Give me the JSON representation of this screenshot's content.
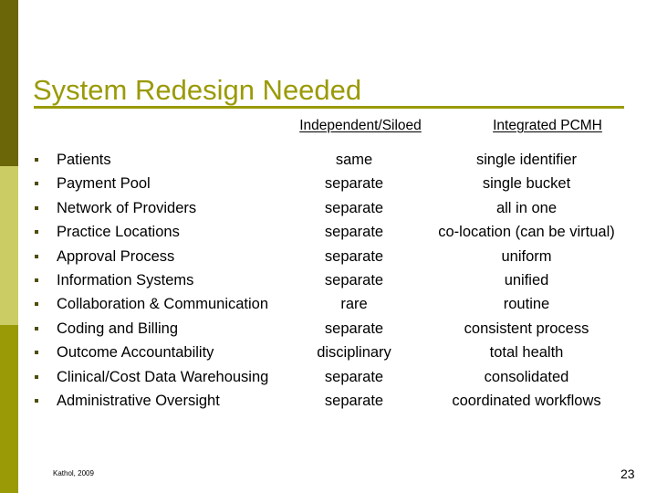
{
  "slide": {
    "title": "System Redesign Needed",
    "citation": "Kathol, 2009",
    "page_number": "23",
    "colors": {
      "title": "#9a9a07",
      "sidebar_top": "#6b6608",
      "sidebar_middle": "#cccc64",
      "sidebar_bottom": "#9a9a07",
      "text": "#000000",
      "bullet": "#4e4d0a",
      "background": "#ffffff"
    }
  },
  "columns": {
    "independent": "Independent/Siloed",
    "integrated": "Integrated PCMH"
  },
  "rows": [
    {
      "label": "Patients",
      "independent": "same",
      "integrated": "single identifier"
    },
    {
      "label": "Payment Pool",
      "independent": "separate",
      "integrated": "single bucket"
    },
    {
      "label": "Network of Providers",
      "independent": "separate",
      "integrated": "all in one"
    },
    {
      "label": "Practice Locations",
      "independent": "separate",
      "integrated": "co-location (can be virtual)"
    },
    {
      "label": "Approval Process",
      "independent": "separate",
      "integrated": "uniform"
    },
    {
      "label": "Information Systems",
      "independent": "separate",
      "integrated": "unified"
    },
    {
      "label": "Collaboration & Communication",
      "independent": "rare",
      "integrated": "routine"
    },
    {
      "label": "Coding and Billing",
      "independent": "separate",
      "integrated": "consistent process"
    },
    {
      "label": "Outcome Accountability",
      "independent": "disciplinary",
      "integrated": "total health"
    },
    {
      "label": "Clinical/Cost Data Warehousing",
      "independent": "separate",
      "integrated": "consolidated"
    },
    {
      "label": "Administrative Oversight",
      "independent": "separate",
      "integrated": "coordinated workflows"
    }
  ]
}
